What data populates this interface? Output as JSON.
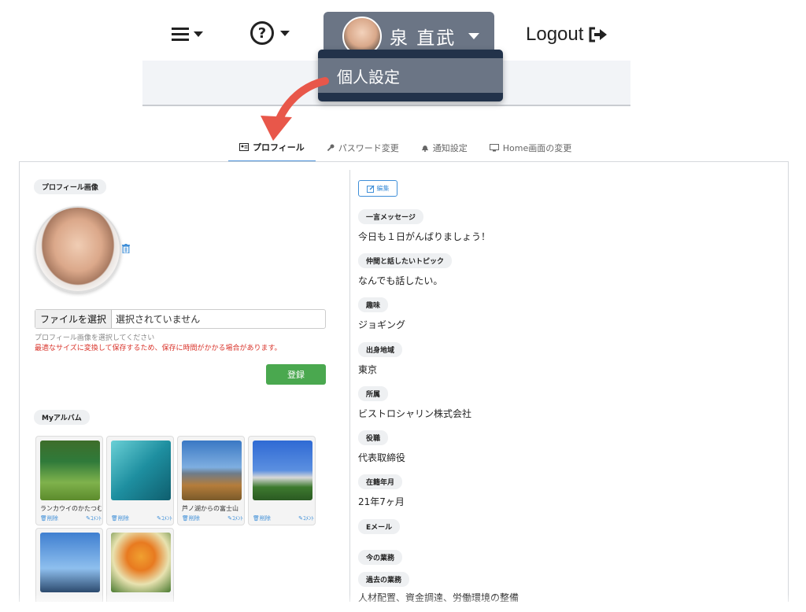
{
  "topbar": {
    "user_name": "泉 直武",
    "logout_label": "Logout",
    "help_symbol": "?"
  },
  "dropdown": {
    "item": "個人設定"
  },
  "tabs": [
    {
      "label": "プロフィール",
      "icon": "id-card-icon"
    },
    {
      "label": "パスワード変更",
      "icon": "key-icon"
    },
    {
      "label": "通知設定",
      "icon": "bell-icon"
    },
    {
      "label": "Home画面の変更",
      "icon": "monitor-icon"
    }
  ],
  "profile": {
    "image_label": "プロフィール画像",
    "file_button": "ファイルを選択",
    "file_status": "選択されていません",
    "hint": "プロフィール画像を選択してください",
    "warning": "最適なサイズに変換して保存するため、保存に時間がかかる場合があります。",
    "submit": "登録"
  },
  "album": {
    "label": "Myアルバム",
    "delete_label": "削除",
    "comment_label": "ｺﾒﾝﾄ",
    "photos": [
      {
        "caption": "ランカウイのかたつむり",
        "colors": [
          "#2f7a3a",
          "#7fb24c"
        ]
      },
      {
        "caption": "",
        "colors": [
          "#1e8fa0",
          "#6ad0d6"
        ]
      },
      {
        "caption": "芦ノ湖からの富士山",
        "colors": [
          "#4a86c8",
          "#b57d3b"
        ]
      },
      {
        "caption": "",
        "colors": [
          "#2f6ad4",
          "#3e7a2f"
        ]
      },
      {
        "caption": "",
        "colors": [
          "#6aa5e6",
          "#2c4a6e"
        ]
      },
      {
        "caption": "",
        "colors": [
          "#f0a030",
          "#e8e2b0"
        ]
      }
    ]
  },
  "details": {
    "edit_label": "編集",
    "fields": [
      {
        "label": "一言メッセージ",
        "value": "今日も１日がんばりましょう！"
      },
      {
        "label": "仲間と話したいトピック",
        "value": "なんでも話したい。"
      },
      {
        "label": "趣味",
        "value": "ジョギング"
      },
      {
        "label": "出身地域",
        "value": "東京"
      },
      {
        "label": "所属",
        "value": "ビストロシャリン株式会社"
      },
      {
        "label": "役職",
        "value": "代表取締役"
      },
      {
        "label": "在籍年月",
        "value": "21年7ヶ月"
      },
      {
        "label": "Eメール",
        "value": ""
      },
      {
        "label": "今の業務",
        "value": ""
      },
      {
        "label": "過去の業務",
        "value": "人材配置、資金調達、労働環境の整備"
      }
    ]
  },
  "colors": {
    "accent": "#3f8fd8",
    "submit": "#4aa84f",
    "warning": "#d9342b",
    "user_button": "#6b7585",
    "dropdown_bg": "#22324a",
    "arrow": "#e8574a"
  }
}
